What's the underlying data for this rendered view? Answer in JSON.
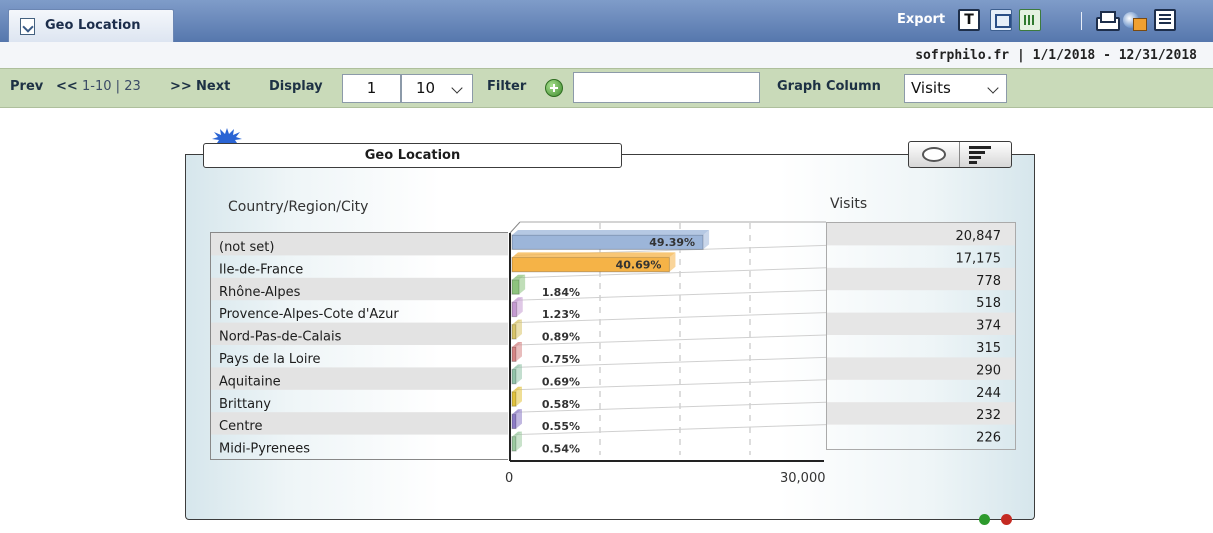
{
  "header": {
    "tab_label": "Geo Location",
    "export_label": "Export",
    "export_text_glyph": "T"
  },
  "subheader": {
    "site": "sofrphilo.fr",
    "separator": "|",
    "date_range": "1/1/2018 - 12/31/2018"
  },
  "toolbar": {
    "prev_label": "Prev",
    "prev_arrows": "<<",
    "range_text": "1-10",
    "range_sep": "|",
    "total": "23",
    "next_arrows": ">>",
    "next_label": "Next",
    "display_label": "Display",
    "display_start": "1",
    "display_count": "10",
    "filter_label": "Filter",
    "filter_value": "",
    "graph_column_label": "Graph Column",
    "graph_column_value": "Visits"
  },
  "chart_panel": {
    "title": "Geo Location",
    "column_label": "Country/Region/City",
    "value_column_label": "Visits"
  },
  "chart_data": {
    "type": "bar",
    "orientation": "horizontal",
    "categories": [
      "(not set)",
      "Ile-de-France",
      "Rhône-Alpes",
      "Provence-Alpes-Cote d'Azur",
      "Nord-Pas-de-Calais",
      "Pays de la Loire",
      "Aquitaine",
      "Brittany",
      "Centre",
      "Midi-Pyrenees"
    ],
    "values": [
      20847,
      17175,
      778,
      518,
      374,
      315,
      290,
      244,
      232,
      226
    ],
    "value_labels": [
      "20,847",
      "17,175",
      "778",
      "518",
      "374",
      "315",
      "290",
      "244",
      "232",
      "226"
    ],
    "percent_labels": [
      "49.39%",
      "40.69%",
      "1.84%",
      "1.23%",
      "0.89%",
      "0.75%",
      "0.69%",
      "0.58%",
      "0.55%",
      "0.54%"
    ],
    "colors": [
      "#9cb5d9",
      "#f5b347",
      "#8dc27d",
      "#c49ad1",
      "#d8c46a",
      "#d58585",
      "#92c3a8",
      "#e1c23e",
      "#8d7cc6",
      "#9ccaa0"
    ],
    "xlim": [
      0,
      30000
    ],
    "xticks": [
      "0",
      "30,000"
    ],
    "ylabel": "Country/Region/City",
    "xlabel": ""
  }
}
